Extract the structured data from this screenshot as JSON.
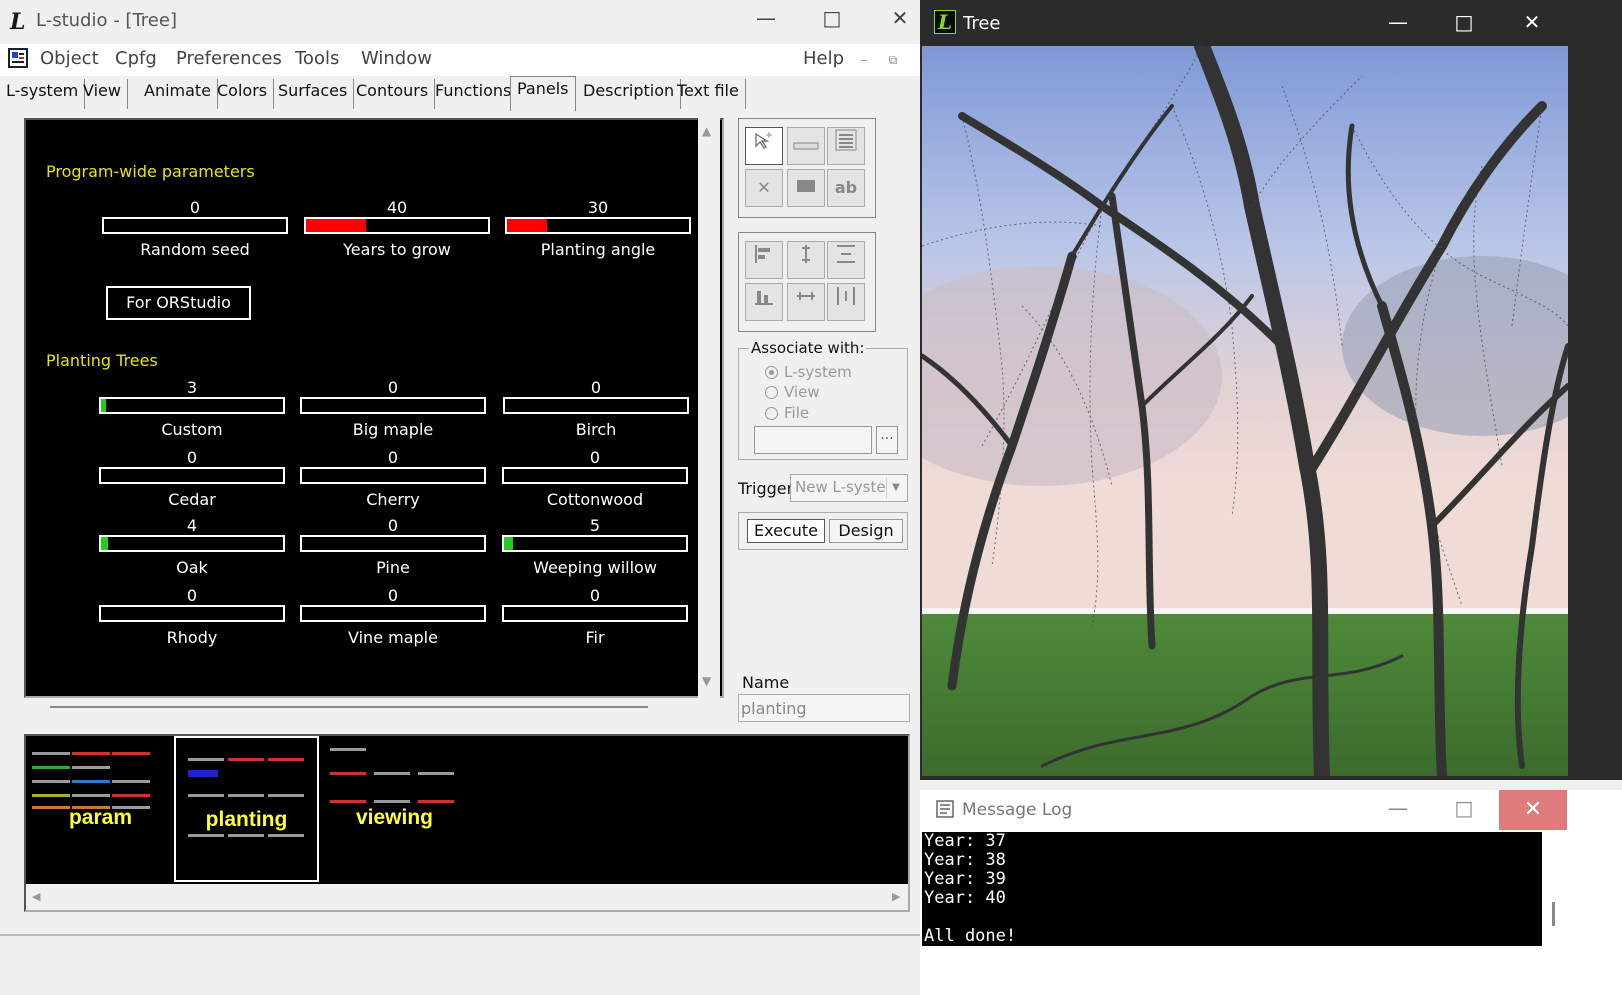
{
  "main_window": {
    "title": "L-studio - [Tree]",
    "logo_letter": "L",
    "menu": [
      "Object",
      "Cpfg",
      "Preferences",
      "Tools",
      "Window"
    ],
    "help": "Help",
    "tabs": [
      "L-system",
      "View",
      "Animate",
      "Colors",
      "Surfaces",
      "Contours",
      "Functions",
      "Panels",
      "Description",
      "Text file"
    ],
    "active_tab": "Panels"
  },
  "panel": {
    "section1_title": "Program-wide parameters",
    "params": [
      {
        "label": "Random seed",
        "value": "0",
        "fill": 0
      },
      {
        "label": "Years to grow",
        "value": "40",
        "fill": 0.33
      },
      {
        "label": "Planting angle",
        "value": "30",
        "fill": 0.22
      }
    ],
    "orstudio_button": "For ORStudio",
    "section2_title": "Planting Trees",
    "trees": [
      {
        "label": "Custom",
        "value": "3",
        "fill": 0.03
      },
      {
        "label": "Big maple",
        "value": "0",
        "fill": 0
      },
      {
        "label": "Birch",
        "value": "0",
        "fill": 0
      },
      {
        "label": "Cedar",
        "value": "0",
        "fill": 0
      },
      {
        "label": "Cherry",
        "value": "0",
        "fill": 0
      },
      {
        "label": "Cottonwood",
        "value": "0",
        "fill": 0
      },
      {
        "label": "Oak",
        "value": "4",
        "fill": 0.04
      },
      {
        "label": "Pine",
        "value": "0",
        "fill": 0
      },
      {
        "label": "Weeping willow",
        "value": "5",
        "fill": 0.05
      },
      {
        "label": "Rhody",
        "value": "0",
        "fill": 0
      },
      {
        "label": "Vine maple",
        "value": "0",
        "fill": 0
      },
      {
        "label": "Fir",
        "value": "0",
        "fill": 0
      }
    ],
    "colors": {
      "red_fill": "#ff0000",
      "green_fill": "#22cc22",
      "title_yellow": "#e6e600"
    }
  },
  "side": {
    "text_tool": "ab",
    "associate_with": "Associate with:",
    "radios": [
      "L-system",
      "View",
      "File"
    ],
    "selected_radio": "L-system",
    "browse": "...",
    "trigger_label": "Trigger",
    "trigger_value": "New L-syste",
    "execute": "Execute",
    "design": "Design",
    "name_label": "Name",
    "name_value": "planting"
  },
  "thumbnails": [
    {
      "name": "param"
    },
    {
      "name": "planting",
      "selected": true
    },
    {
      "name": "viewing"
    }
  ],
  "tree_window": {
    "title": "Tree",
    "logo_letter": "L"
  },
  "message_log": {
    "title": "Message Log",
    "lines": [
      "Year: 37",
      "Year: 38",
      "Year: 39",
      "Year: 40",
      "",
      "All done!"
    ]
  }
}
